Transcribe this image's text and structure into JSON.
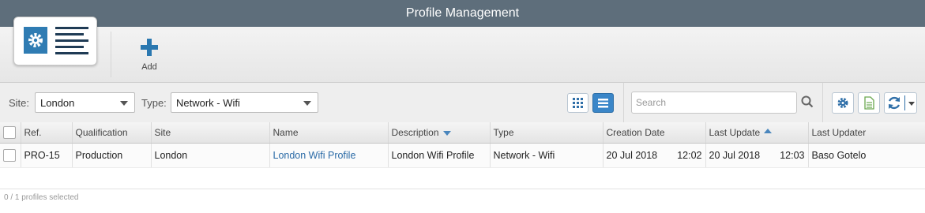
{
  "window": {
    "title": "Profile Management"
  },
  "toolbar": {
    "app_icon": "profile-management-icon",
    "add_label": "Add",
    "add_icon": "plus-icon"
  },
  "filters": {
    "site_label": "Site:",
    "site_value": "London",
    "type_label": "Type:",
    "type_value": "Network - Wifi"
  },
  "view_toggle": {
    "grid_icon": "grid-view-icon",
    "list_icon": "list-view-icon",
    "active": "list"
  },
  "search": {
    "placeholder": "Search",
    "icon": "magnifier-icon"
  },
  "actions": {
    "settings_icon": "gear-icon",
    "export_icon": "document-icon",
    "refresh_icon": "refresh-icon",
    "dropdown_icon": "caret-down-icon"
  },
  "table": {
    "columns": {
      "ref": "Ref.",
      "qualification": "Qualification",
      "site": "Site",
      "name": "Name",
      "description": "Description",
      "type": "Type",
      "creation_date": "Creation Date",
      "last_update": "Last Update",
      "last_updater": "Last Updater"
    },
    "sort": {
      "description": "descending",
      "last_update": "ascending"
    },
    "rows": [
      {
        "ref": "PRO-15",
        "qualification": "Production",
        "site": "London",
        "name": "London Wifi Profile",
        "description": "London Wifi Profile",
        "type": "Network - Wifi",
        "creation_date": "20 Jul 2018",
        "creation_time": "12:02",
        "last_update_date": "20 Jul 2018",
        "last_update_time": "12:03",
        "last_updater": "Baso Gotelo"
      }
    ]
  },
  "status": {
    "selection": "0 / 1 profiles selected"
  },
  "colors": {
    "titlebar": "#5e6e7b",
    "accent": "#2b78b0",
    "link": "#2a6aa6"
  }
}
